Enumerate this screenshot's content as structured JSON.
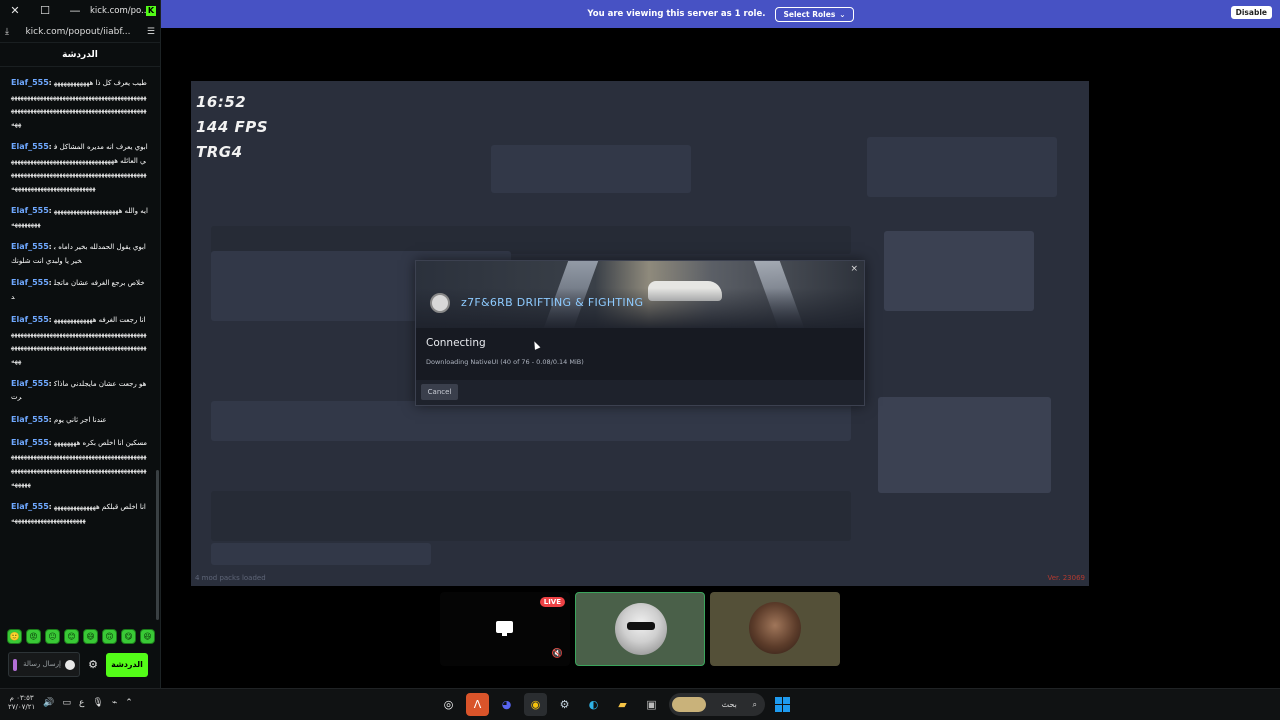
{
  "chat_window": {
    "titlebar": {
      "close": "✕",
      "restore": "☐",
      "minimize": "—",
      "title": "kick.com/po..."
    },
    "urlbar": {
      "url": "kick.com/popout/iiabf..."
    },
    "header": "الدردشة",
    "messages": [
      {
        "user": "Elaf_555",
        "text": "طيب يعرف كل ذا ههههههههههههههههههههههههههههههههههههههههههههههههههههههههههههههههههههههههههههههههههههههههههههههههههه"
      },
      {
        "user": "Elaf_555",
        "text": "ابوي يعرف انه مديره المشاكل في العائله ههههههههههههههههههههههههههههههههههههههههههههههههههههههههههههههههههههههههههههههههههههههههههههههههههههه"
      },
      {
        "user": "Elaf_555",
        "text": "ايه والله هههههههههههههههههههههههههههههه"
      },
      {
        "user": "Elaf_555",
        "text": "ابوي يقول الحمدلله بخير داماه بخير يا ولبدي انت شلونك"
      },
      {
        "user": "Elaf_555",
        "text": "خلاص برجع الغرفه عشان ماتجلد"
      },
      {
        "user": "Elaf_555",
        "text": "انا رجعت الغرفه هههههههههههههههههههههههههههههههههههههههههههههههههههههههههههههههههههههههههههههههههههههههههههههههههههه"
      },
      {
        "user": "Elaf_555",
        "text": "هو رجعت عشان مايجلدني ماذاكرت"
      },
      {
        "user": "Elaf_555",
        "text": "عندنا اجر ثاني يوم"
      },
      {
        "user": "Elaf_555",
        "text": "مسكين انا اخلص بكره هههههههههههههههههههههههههههههههههههههههههههههههههههههههههههههههههههههههههههههههههههههههههههههههههه"
      },
      {
        "user": "Elaf_555",
        "text": "انا اخلص قبلكم ههههههههههههههههههههههههههههههههههههه"
      }
    ],
    "emotes": [
      "🙂",
      "😡",
      "😐",
      "😊",
      "😄",
      "🙃",
      "😋",
      "😆",
      "😛"
    ],
    "input_placeholder": "إرسال رسالة",
    "send_label": "الدردشة"
  },
  "share_bar": {
    "message": "You are viewing this server as 1 role.",
    "select_roles": "Select Roles",
    "disable": "Disable"
  },
  "game": {
    "overlay": {
      "time": "16:52",
      "fps": "144 FPS",
      "tag": "TRG4"
    },
    "dialog": {
      "server_name": "z7F&6RB DRIFTING & FIGHTING",
      "close": "×",
      "status": "Connecting",
      "detail": "Downloading NativeUI (40 of 76 - 0.08/0.14 MiB)",
      "cancel": "Cancel"
    },
    "mod_packs": "4 mod packs loaded",
    "version": "Ver. 23069"
  },
  "tiles": {
    "live": "LIVE"
  },
  "taskbar": {
    "time": "٠٣:٥٣ م",
    "date": "٢٧/٠٧/٢١",
    "lang": "ع",
    "search_label": "بحث"
  }
}
